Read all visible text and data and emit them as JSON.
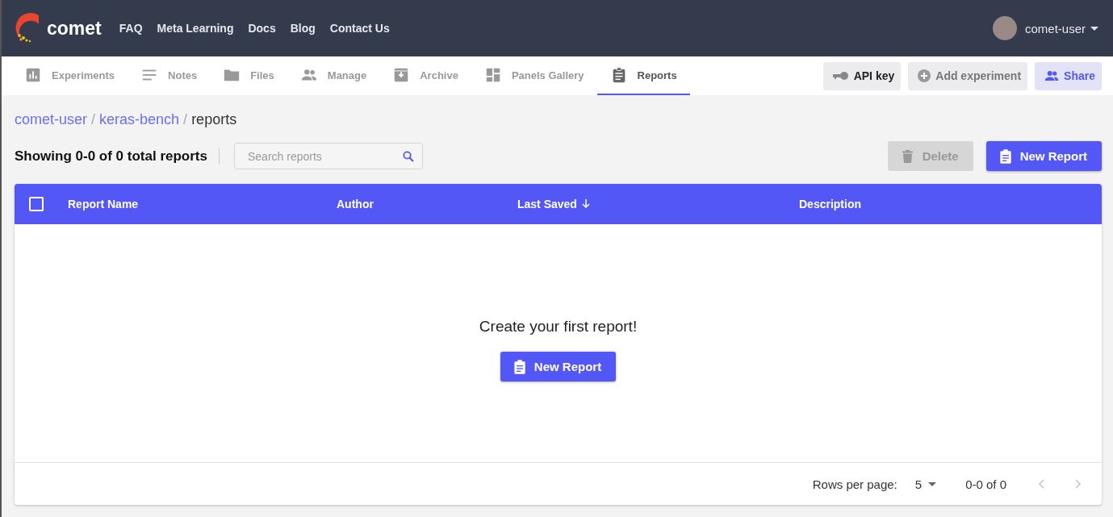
{
  "header": {
    "brand": "comet",
    "nav": [
      "FAQ",
      "Meta Learning",
      "Docs",
      "Blog",
      "Contact Us"
    ],
    "user": "comet-user"
  },
  "tabs": [
    {
      "label": "Experiments",
      "kind": "chart",
      "selected": false
    },
    {
      "label": "Notes",
      "kind": "notes",
      "selected": false
    },
    {
      "label": "Files",
      "kind": "folder",
      "selected": false
    },
    {
      "label": "Manage",
      "kind": "people",
      "selected": false
    },
    {
      "label": "Archive",
      "kind": "archive",
      "selected": false
    },
    {
      "label": "Panels Gallery",
      "kind": "panels",
      "selected": false
    },
    {
      "label": "Reports",
      "kind": "clipboard",
      "selected": true
    }
  ],
  "actions": [
    {
      "label": "API key",
      "kind": "key"
    },
    {
      "label": "Add experiment",
      "kind": "add"
    },
    {
      "label": "Share",
      "kind": "share"
    }
  ],
  "breadcrumb": {
    "items": [
      "comet-user",
      "keras-bench",
      "reports"
    ],
    "separator": "/"
  },
  "summary": "Showing 0-0 of 0 total reports",
  "search": {
    "placeholder": "Search reports"
  },
  "delete_button": {
    "label": "Delete",
    "disabled": true
  },
  "new_report_button": "New Report",
  "table": {
    "select_all_checked": false,
    "columns": [
      {
        "label": "Report Name",
        "sorted": false
      },
      {
        "label": "Author",
        "sorted": false
      },
      {
        "label": "Last Saved",
        "sorted": true
      },
      {
        "label": "Description",
        "sorted": false
      }
    ]
  },
  "empty_state": {
    "message": "Create your first report!",
    "button": "New Report"
  },
  "pagination": {
    "rows_label": "Rows per page:",
    "rows_value": "5",
    "range": "0-0 of 0",
    "prev_disabled": true,
    "next_disabled": true
  }
}
